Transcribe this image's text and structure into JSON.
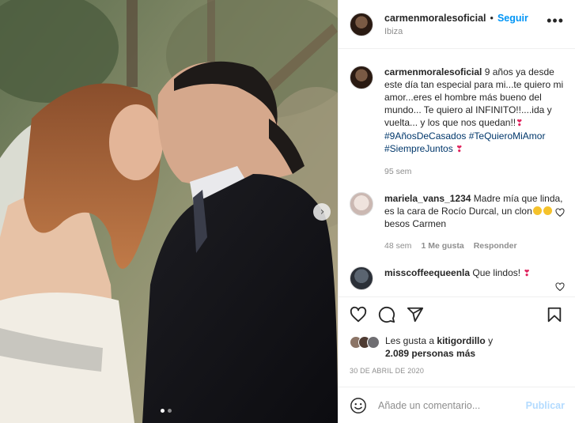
{
  "post": {
    "author": "carmenmoralesoficial",
    "follow_label": "Seguir",
    "separator": "•",
    "location": "Ibiza",
    "more_label": "•••"
  },
  "caption": {
    "author": "carmenmoralesoficial",
    "text": "9 años ya desde este día tan especial para mi...te quiero mi amor...eres el hombre más bueno del mundo... Te quiero al INFINITO!!....ida y vuelta... y los que nos quedan!!",
    "hashtags": [
      "#9AñosDeCasados",
      "#TeQuieroMiAmor",
      "#SiempreJuntos"
    ],
    "time": "95 sem"
  },
  "comments": [
    {
      "author": "mariela_vans_1234",
      "text": "Madre mía que linda, es la cara de Rocío Durcal, un clon",
      "text_tail": "besos Carmen",
      "time": "48 sem",
      "likes": "1 Me gusta",
      "reply": "Responder"
    },
    {
      "author": "misscoffeequeenla",
      "text": "Que lindos!"
    }
  ],
  "likes": {
    "prefix": "Les gusta a",
    "user": "kitigordillo",
    "joiner": "y",
    "count": "2.089 personas más"
  },
  "date": "30 DE ABRIL DE 2020",
  "composer": {
    "placeholder": "Añade un comentario...",
    "publish": "Publicar"
  },
  "carousel": {
    "current": 1,
    "total": 2
  },
  "colors": {
    "accent": "#0095f6",
    "hashtag": "#00376b",
    "meta": "#8e8e8e",
    "publish_disabled": "#b3dbff"
  },
  "icons": [
    "heart-icon",
    "comment-icon",
    "share-icon",
    "bookmark-icon",
    "emoji-icon",
    "chevron-right-icon",
    "more-icon"
  ]
}
